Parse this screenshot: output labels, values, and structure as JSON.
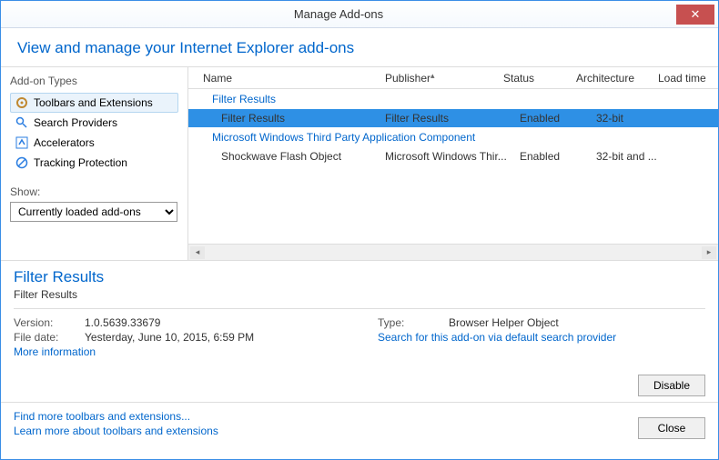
{
  "window": {
    "title": "Manage Add-ons"
  },
  "header": {
    "title": "View and manage your Internet Explorer add-ons"
  },
  "sidebar": {
    "label": "Add-on Types",
    "items": [
      {
        "label": "Toolbars and Extensions"
      },
      {
        "label": "Search Providers"
      },
      {
        "label": "Accelerators"
      },
      {
        "label": "Tracking Protection"
      }
    ],
    "show_label": "Show:",
    "show_value": "Currently loaded add-ons"
  },
  "table": {
    "cols": {
      "name": "Name",
      "publisher": "Publisher",
      "status": "Status",
      "arch": "Architecture",
      "load": "Load time"
    },
    "groups": [
      {
        "label": "Filter Results",
        "rows": [
          {
            "name": "Filter Results",
            "publisher": "Filter Results",
            "status": "Enabled",
            "arch": "32-bit",
            "selected": true
          }
        ]
      },
      {
        "label": "Microsoft Windows Third Party Application Component",
        "rows": [
          {
            "name": "Shockwave Flash Object",
            "publisher": "Microsoft Windows Thir...",
            "status": "Enabled",
            "arch": "32-bit and ...",
            "selected": false
          }
        ]
      }
    ]
  },
  "details": {
    "title": "Filter Results",
    "subtitle": "Filter Results",
    "version_label": "Version:",
    "version": "1.0.5639.33679",
    "filedate_label": "File date:",
    "filedate": "Yesterday, June 10, 2015, 6:59 PM",
    "more_info": "More information",
    "type_label": "Type:",
    "type": "Browser Helper Object",
    "search_link": "Search for this add-on via default search provider"
  },
  "footer": {
    "link1": "Find more toolbars and extensions...",
    "link2": "Learn more about toolbars and extensions",
    "disable": "Disable",
    "close": "Close"
  }
}
